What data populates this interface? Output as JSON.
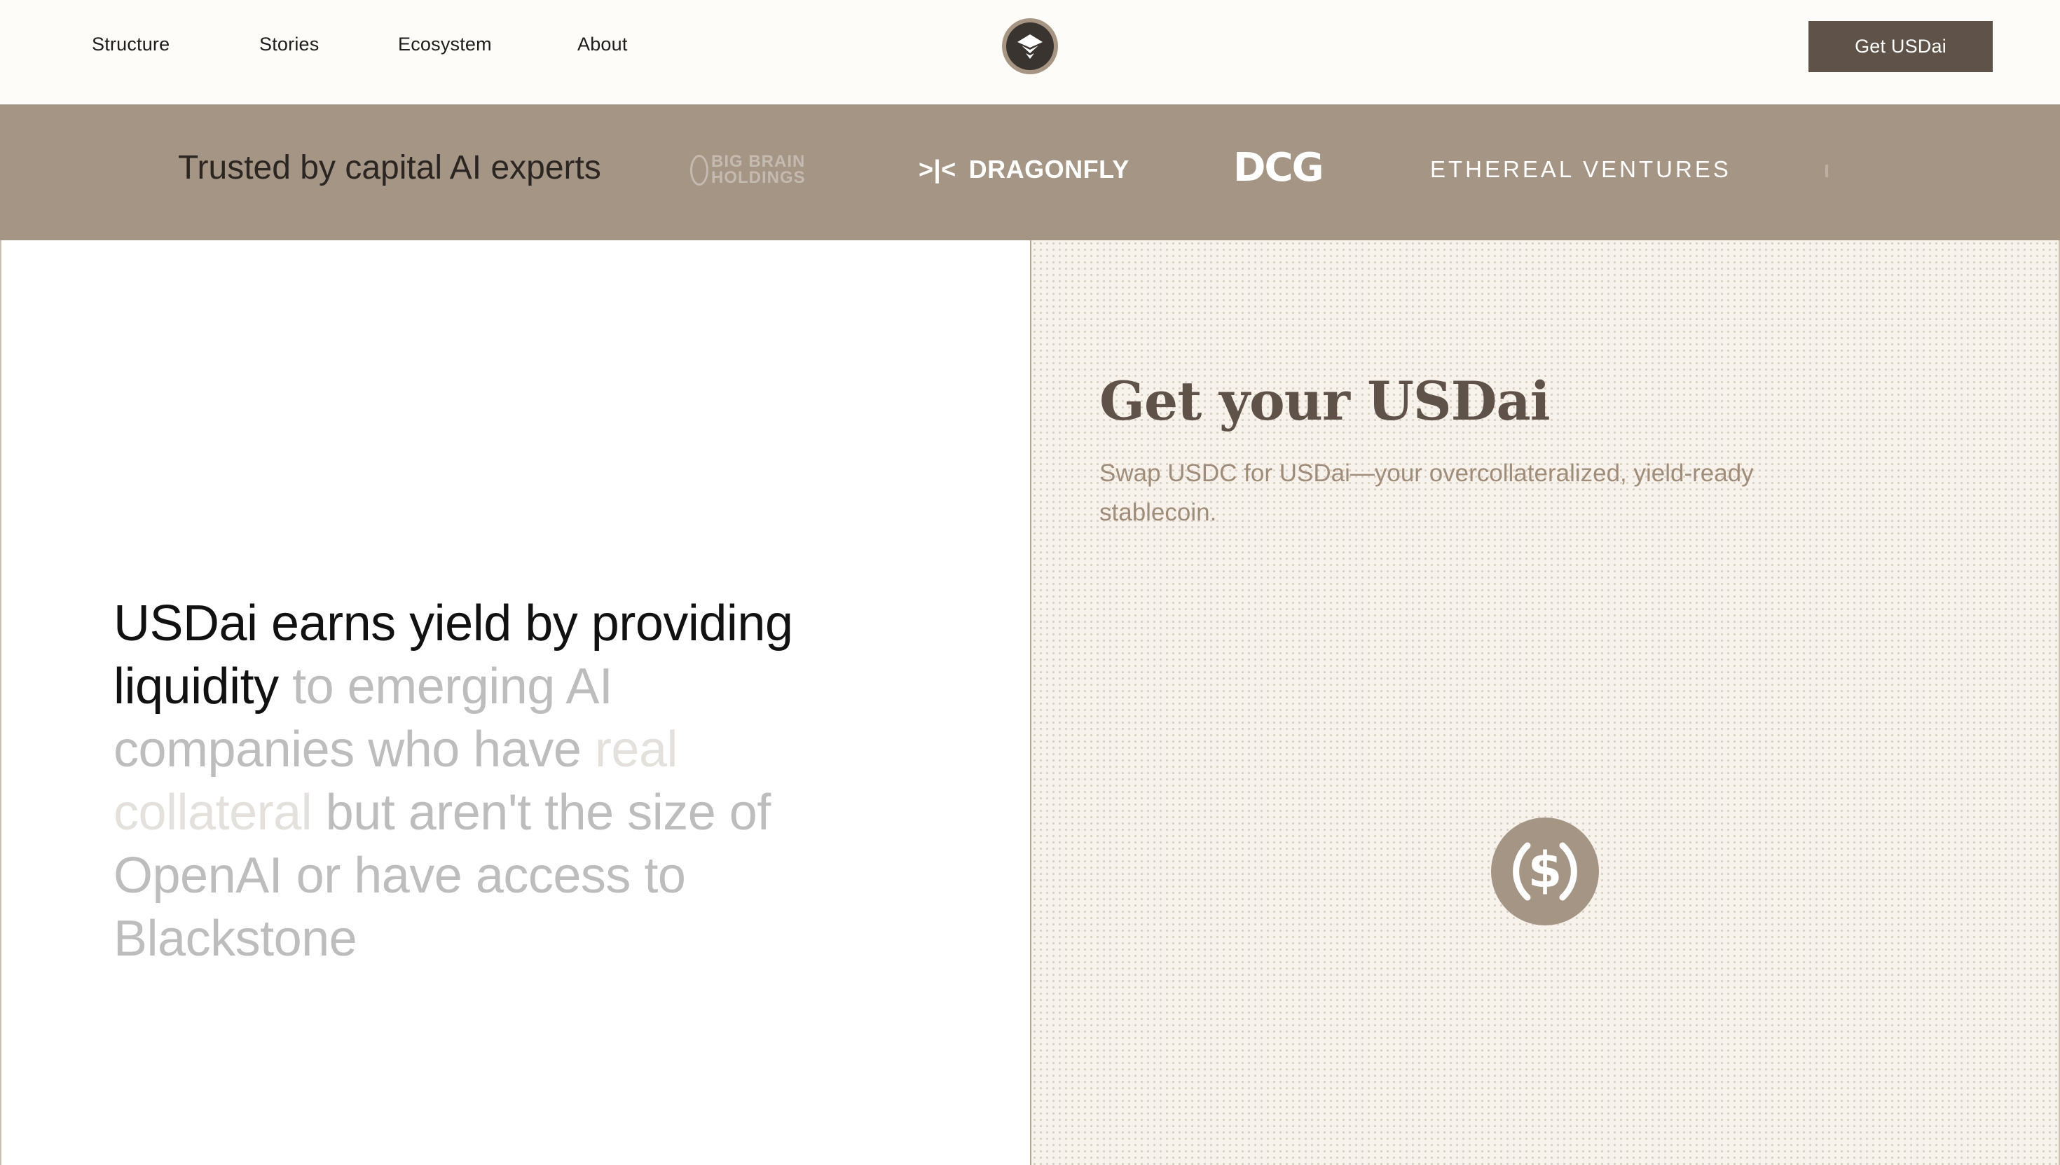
{
  "header": {
    "nav": [
      "Structure",
      "Stories",
      "Ecosystem",
      "About"
    ],
    "logo_icon": "usdai-logo-icon",
    "cta_label": "Get USDai"
  },
  "partners_band": {
    "title": "Trusted by capital AI experts",
    "logos": {
      "big_brain_line1": "BIG BRAIN",
      "big_brain_line2": "HOLDINGS",
      "dragonfly_mark": ">|<",
      "dragonfly": "DRAGONFLY",
      "dcg": "DCG",
      "ethereal": "ETHEREAL VENTURES"
    }
  },
  "statement": {
    "part1": "USDai earns yield by providing liquidity",
    "part2": " to emerging AI companies who have ",
    "part3": "real collateral",
    "part4": " but aren't the size of OpenAI or have access to Blackstone"
  },
  "swap_panel": {
    "title": "Get your USDai",
    "subtitle": "Swap USDC for USDai—your overcollateralized, yield-ready stablecoin.",
    "coin_icon": "usdc-coin-icon"
  },
  "colors": {
    "brand": "#5f5248",
    "band": "#a59584",
    "panel_bg": "#f7f3ec"
  }
}
